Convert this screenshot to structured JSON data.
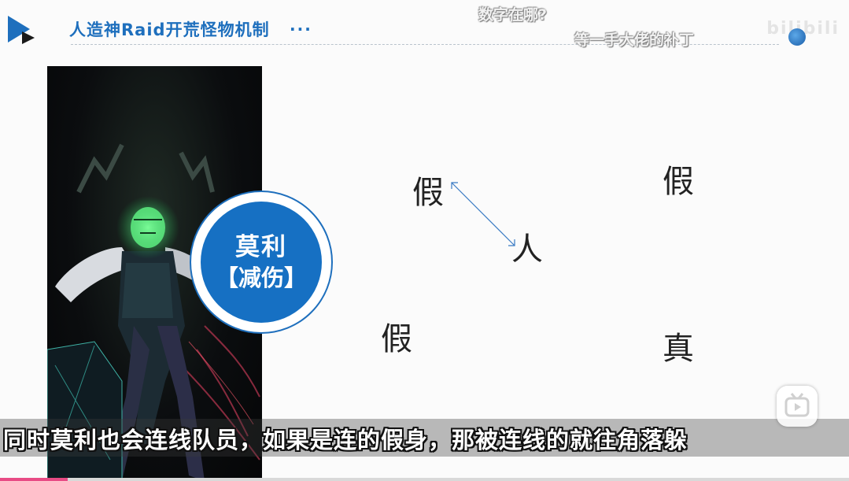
{
  "header": {
    "title": "人造神Raid开荒怪物机制",
    "title_dots": "..."
  },
  "danmaku": [
    {
      "text": "数字在哪?"
    },
    {
      "text": "等一手大佬的补丁"
    }
  ],
  "watermark": {
    "text": "bilibili"
  },
  "badge": {
    "name": "莫利",
    "role": "【减伤】"
  },
  "positions": {
    "top_left": "假",
    "top_right": "假",
    "center": "人",
    "bottom_left": "假",
    "bottom_right": "真"
  },
  "subtitle": {
    "text": "同时莫利也会连线队员，如果是连的假身，那被连线的就往角落躲"
  },
  "player": {
    "progress": 0.08
  },
  "colors": {
    "accent": "#1e6fbd",
    "badge": "#1670c3",
    "progress": "#e84b85"
  }
}
